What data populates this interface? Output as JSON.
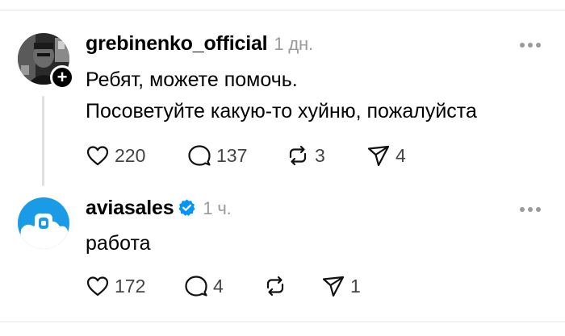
{
  "posts": [
    {
      "username": "grebinenko_official",
      "time": "1 дн.",
      "lines": [
        "Ребят, можете помочь.",
        "Посоветуйте какую-то хуйню, пожалуйста"
      ],
      "likes": "220",
      "replies": "137",
      "reposts": "3",
      "shares": "4"
    },
    {
      "username": "aviasales",
      "verified": true,
      "time": "1 ч.",
      "lines": [
        "работа"
      ],
      "likes": "172",
      "replies": "4",
      "reposts": "",
      "shares": "1"
    }
  ],
  "colors": {
    "verified_blue": "#0095f6",
    "aviasales_blue": "#1a9be8",
    "muted_gray": "#9a9a9a"
  },
  "icons": [
    "heart-icon",
    "comment-icon",
    "repost-icon",
    "share-icon",
    "more-icon",
    "plus-icon",
    "verified-badge-icon"
  ]
}
